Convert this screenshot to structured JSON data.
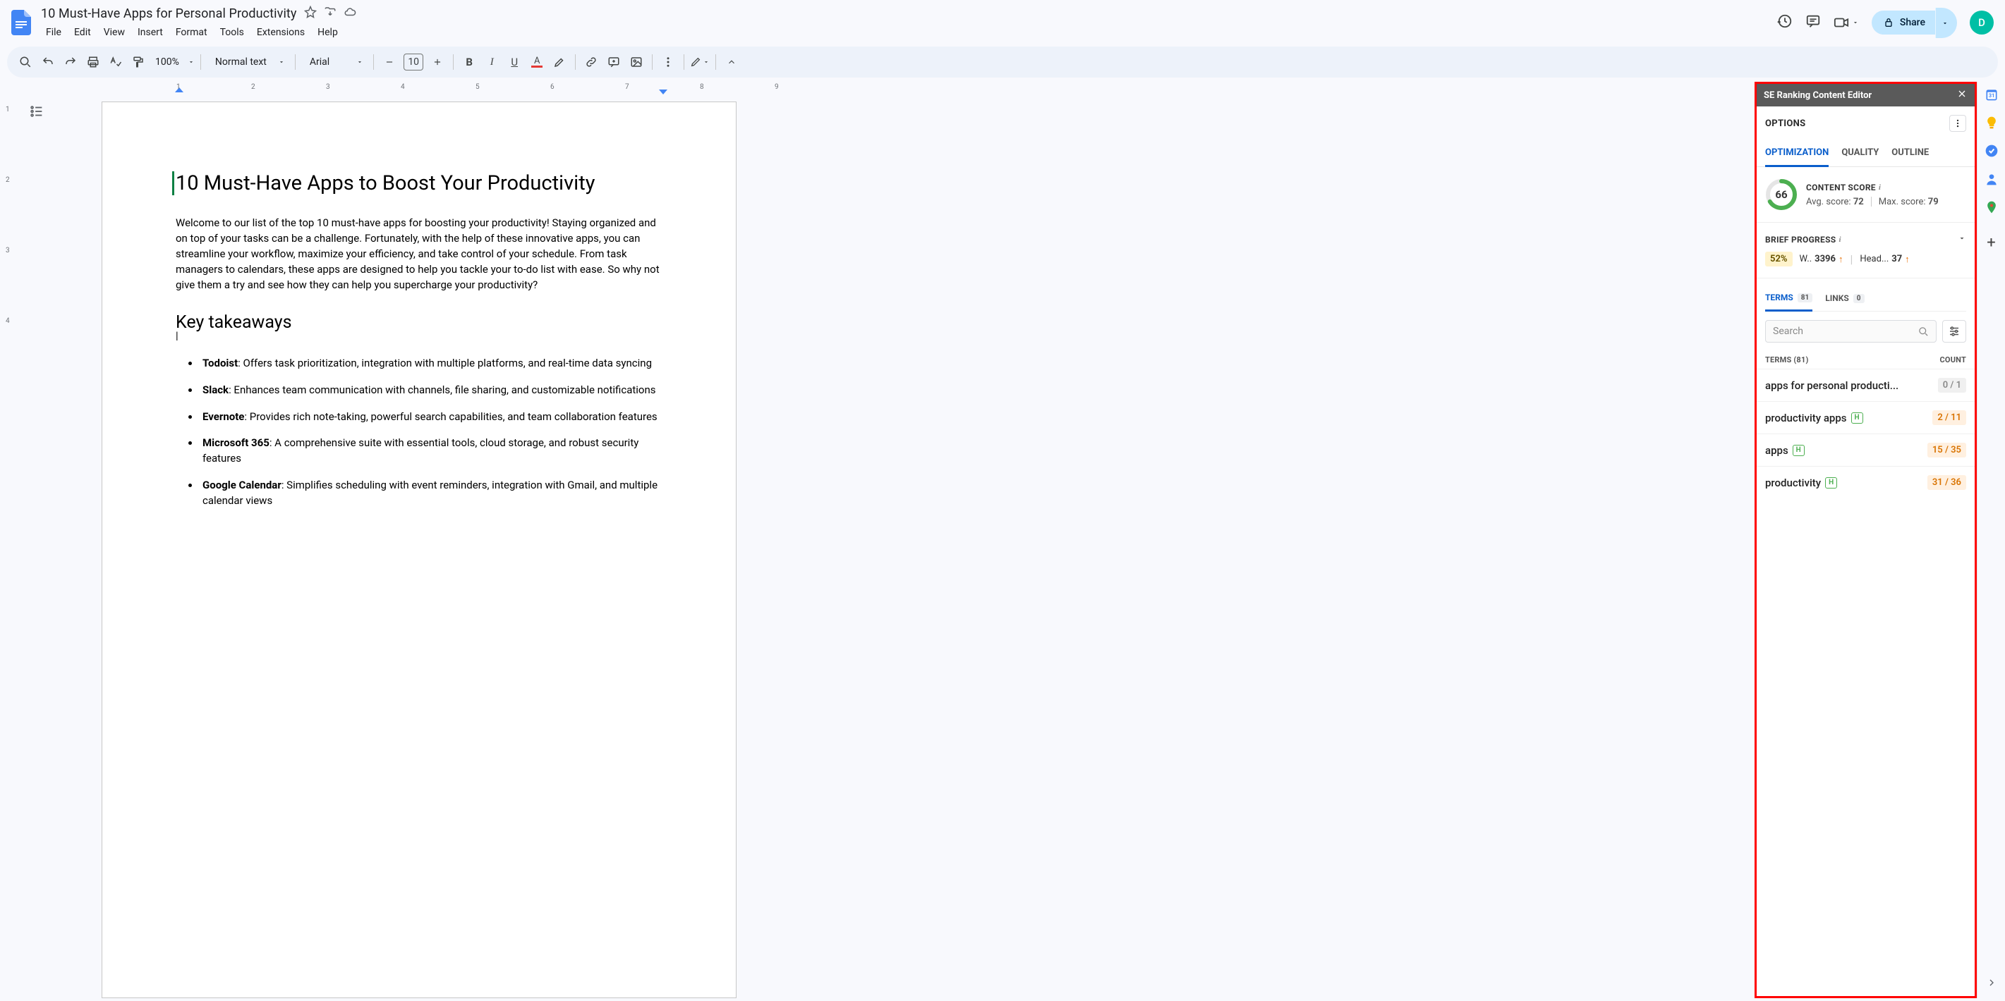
{
  "doc_title": "10 Must-Have Apps for Personal Productivity",
  "menus": [
    "File",
    "Edit",
    "View",
    "Insert",
    "Format",
    "Tools",
    "Extensions",
    "Help"
  ],
  "toolbar": {
    "zoom": "100%",
    "style": "Normal text",
    "font": "Arial",
    "font_size": "10"
  },
  "share_label": "Share",
  "avatar_letter": "D",
  "ruler_h": [
    "1",
    "2",
    "3",
    "4",
    "5",
    "6",
    "7",
    "8",
    "9"
  ],
  "ruler_v": [
    "1",
    "2",
    "3",
    "4"
  ],
  "doc": {
    "h1": "10 Must-Have Apps to Boost Your Productivity",
    "intro": "Welcome to our list of the top 10 must-have apps for boosting your productivity! Staying organized and on top of your tasks can be a challenge. Fortunately, with the help of these innovative apps, you can streamline your workflow, maximize your efficiency, and take control of your schedule. From task managers to calendars, these apps are designed to help you tackle your to-do list with ease. So why not give them a try and see how they can help you supercharge your productivity?",
    "h2": "Key takeaways",
    "bullets": [
      {
        "b": "Todoist",
        "rest": ": Offers task prioritization, integration with multiple platforms, and real-time data syncing"
      },
      {
        "b": "Slack",
        "rest": ": Enhances team communication with channels, file sharing, and customizable notifications"
      },
      {
        "b": "Evernote",
        "rest": ": Provides rich note-taking, powerful search capabilities, and team collaboration features"
      },
      {
        "b": "Microsoft 365",
        "rest": ": A comprehensive suite with essential tools, cloud storage, and robust security features"
      },
      {
        "b": "Google Calendar",
        "rest": ": Simplifies scheduling with event reminders, integration with Gmail, and multiple calendar views"
      }
    ]
  },
  "sidebar": {
    "title": "SE Ranking Content Editor",
    "options_label": "OPTIONS",
    "tabs": [
      "OPTIMIZATION",
      "QUALITY",
      "OUTLINE"
    ],
    "content_score_label": "CONTENT SCORE",
    "score": "66",
    "avg_label": "Avg. score: ",
    "avg_val": "72",
    "max_label": "Max. score: ",
    "max_val": "79",
    "brief_label": "BRIEF PROGRESS",
    "brief_pct": "52%",
    "words_label": "W..",
    "words_val": "3396",
    "heads_label": "Head...",
    "heads_val": "37",
    "terms_tab": "TERMS",
    "terms_count": "81",
    "links_tab": "LINKS",
    "links_count": "0",
    "search_placeholder": "Search",
    "terms_header": "TERMS (81)",
    "count_header": "COUNT",
    "term_rows": [
      {
        "name": "apps for personal producti...",
        "h": false,
        "count": "0 / 1",
        "cls": "count-gray"
      },
      {
        "name": "productivity apps",
        "h": true,
        "count": "2 / 11",
        "cls": "count-orange"
      },
      {
        "name": "apps",
        "h": true,
        "count": "15 / 35",
        "cls": "count-orange"
      },
      {
        "name": "productivity",
        "h": true,
        "count": "31 / 36",
        "cls": "count-orange"
      }
    ]
  }
}
